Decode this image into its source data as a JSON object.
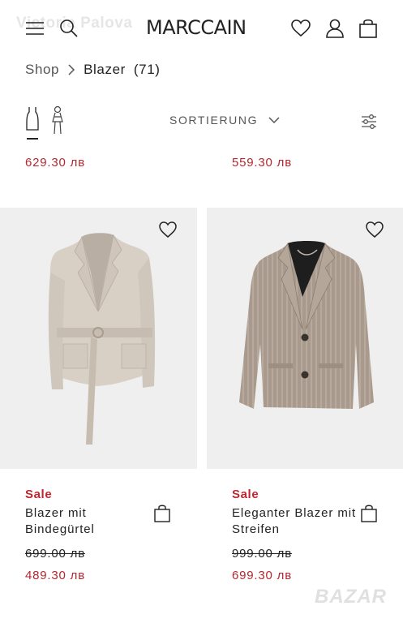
{
  "watermark": "Victoria Palova",
  "header": {
    "logo": "MARCCAIN",
    "icons": [
      "menu-icon",
      "search-icon",
      "heart-icon",
      "user-icon",
      "bag-icon"
    ]
  },
  "breadcrumb": {
    "shop": "Shop",
    "category": "Blazer",
    "count": "(71)"
  },
  "toolbar": {
    "sort_label": "SORTIERUNG"
  },
  "previous_row": {
    "left_price": "629.30 лв",
    "right_price": "559.30 лв"
  },
  "products": [
    {
      "sale": "Sale",
      "name": "Blazer mit Bindegürtel",
      "old_price": "699.00 лв",
      "new_price": "489.30 лв",
      "image": "beige belted blazer"
    },
    {
      "sale": "Sale",
      "name": "Eleganter Blazer mit Streifen",
      "old_price": "999.00 лв",
      "new_price": "699.30 лв",
      "image": "brown pinstripe blazer"
    }
  ],
  "footer_watermark": "BAZAR",
  "colors": {
    "accent": "#b5272f",
    "image_bg": "#efeff0",
    "text": "#222222"
  }
}
